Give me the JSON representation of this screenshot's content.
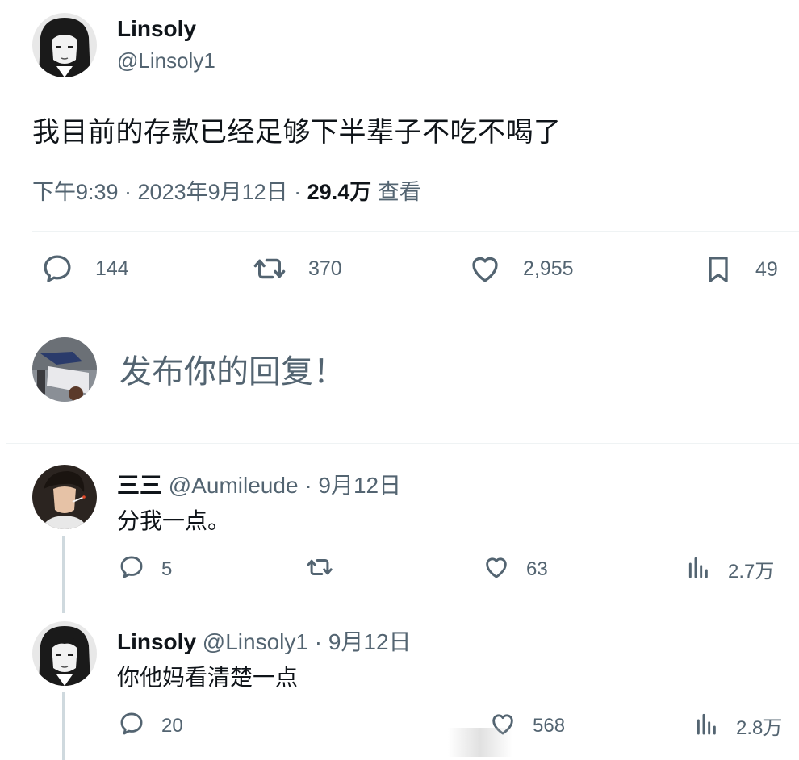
{
  "tweet": {
    "author_name": "Linsoly",
    "author_handle": "@Linsoly1",
    "text": "我目前的存款已经足够下半辈子不吃不喝了",
    "time": "下午9:39 · 2023年9月12日 · ",
    "views_count": "29.4万",
    "views_label": " 查看",
    "actions": {
      "reply_count": "144",
      "retweet_count": "370",
      "like_count": "2,955",
      "bookmark_count": "49"
    }
  },
  "composer": {
    "placeholder": "发布你的回复！"
  },
  "replies": [
    {
      "name": "三三",
      "handle": "@Aumileude",
      "date": "· 9月12日",
      "text": "分我一点。",
      "reply_count": "5",
      "retweet_count": "",
      "like_count": "63",
      "views_count": "2.7万"
    },
    {
      "name": "Linsoly",
      "handle": "@Linsoly1",
      "date": "· 9月12日",
      "text": "你他妈看清楚一点",
      "reply_count": "20",
      "like_count": "568",
      "views_count": "2.8万"
    }
  ],
  "icons": {
    "reply": "reply-icon",
    "retweet": "retweet-icon",
    "like": "heart-icon",
    "bookmark": "bookmark-icon",
    "views": "views-icon"
  },
  "colors": {
    "text_primary": "#0f1419",
    "text_secondary": "#536471",
    "divider": "#eff3f4",
    "thread_line": "#cfd9de"
  }
}
